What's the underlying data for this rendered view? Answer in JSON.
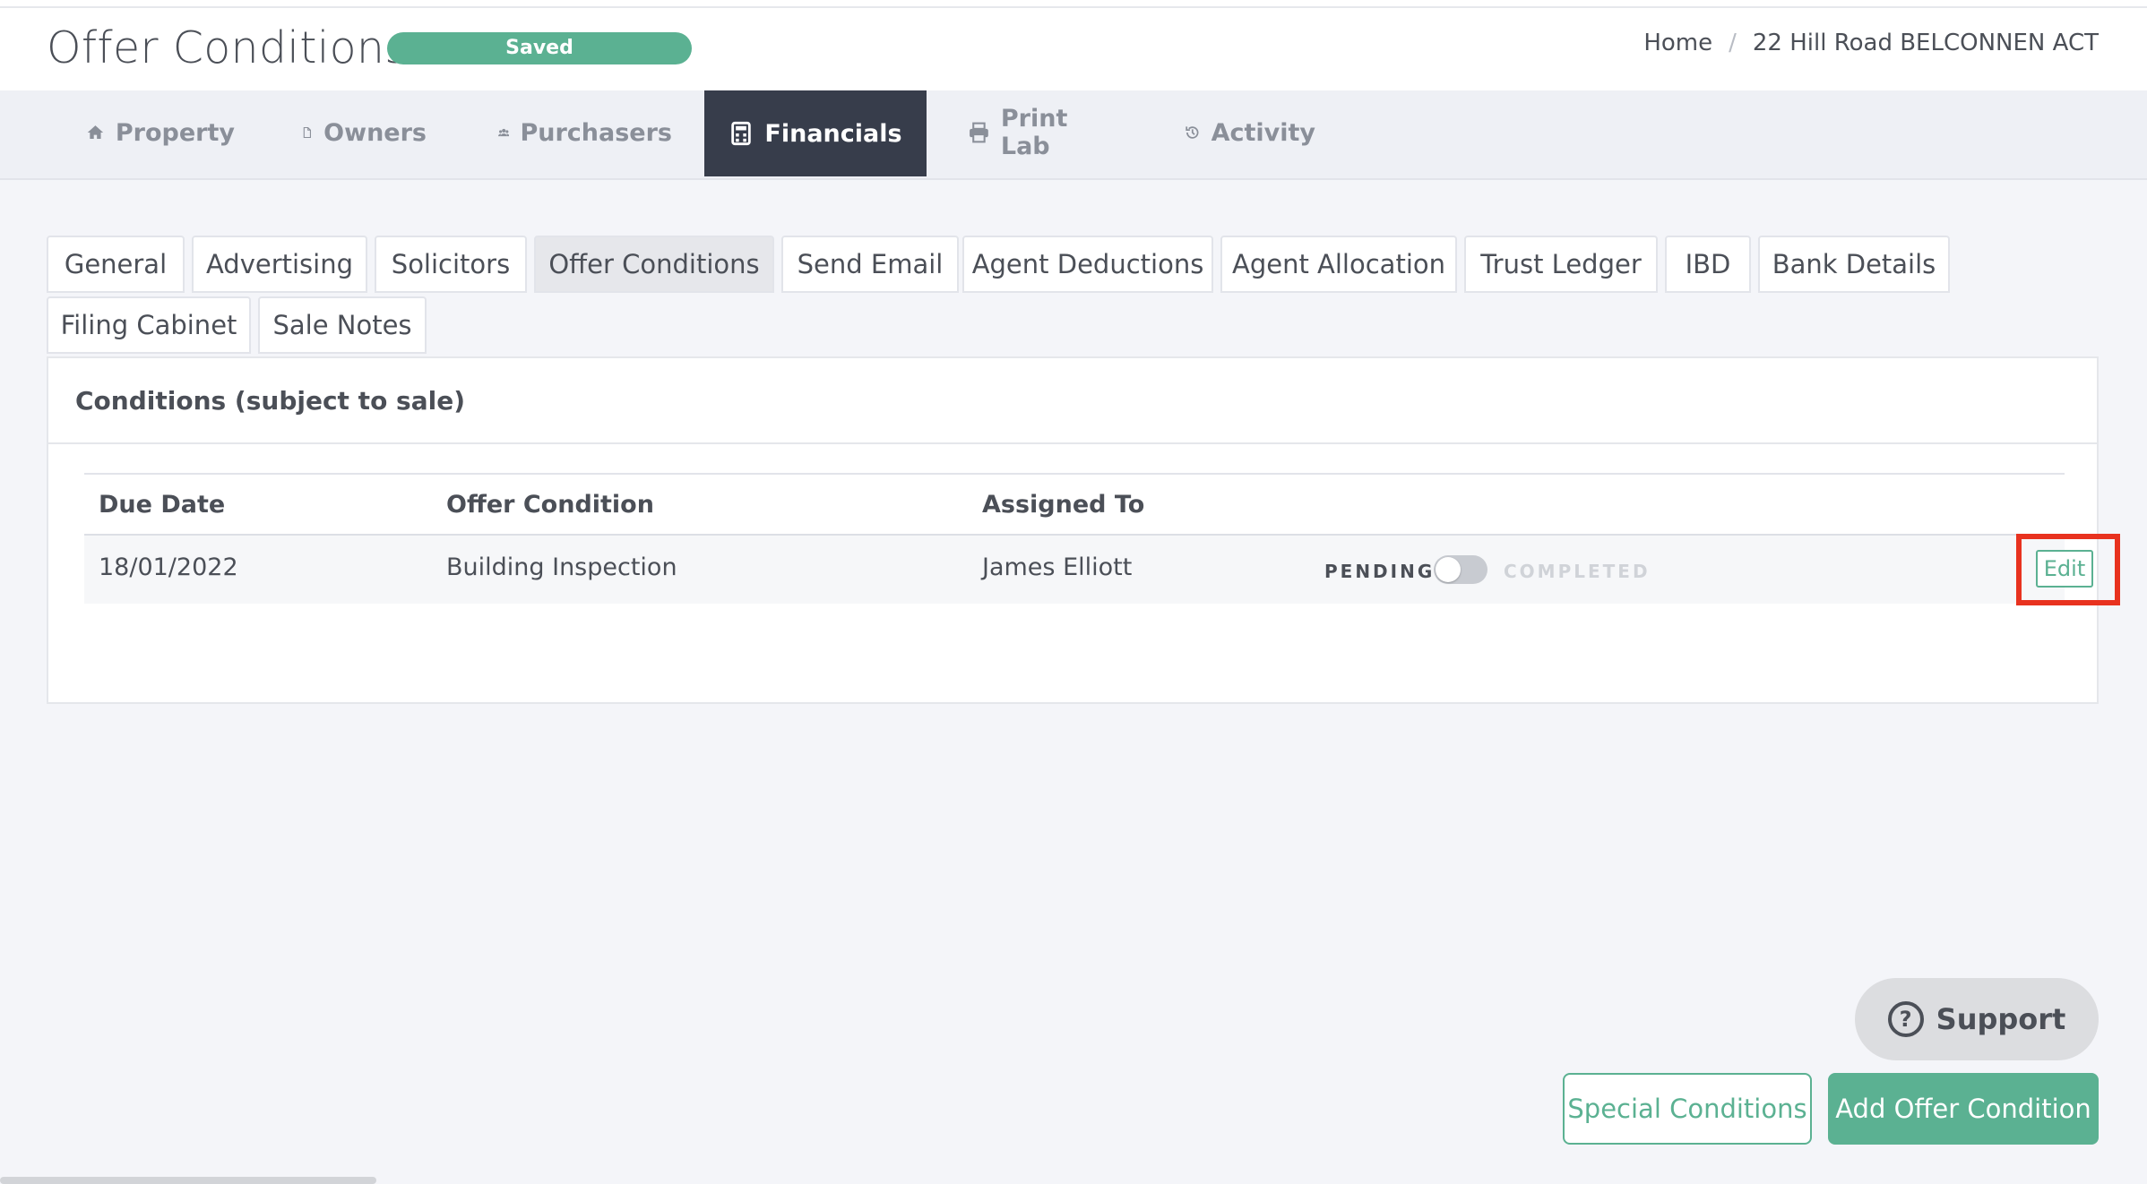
{
  "header": {
    "title": "Offer Conditions",
    "status_badge": "Saved",
    "breadcrumb": [
      "Home",
      "22 Hill Road BELCONNEN ACT"
    ]
  },
  "main_tabs": [
    {
      "label": "Property",
      "icon": "home-icon"
    },
    {
      "label": "Owners",
      "icon": "document-icon"
    },
    {
      "label": "Purchasers",
      "icon": "users-icon"
    },
    {
      "label": "Financials",
      "icon": "calculator-icon",
      "active": true
    },
    {
      "label": "Print Lab",
      "icon": "printer-icon"
    },
    {
      "label": "Activity",
      "icon": "history-icon"
    }
  ],
  "sub_tabs": [
    {
      "label": "General"
    },
    {
      "label": "Advertising"
    },
    {
      "label": "Solicitors"
    },
    {
      "label": "Offer Conditions",
      "active": true
    },
    {
      "label": "Send Email"
    },
    {
      "label": "Agent Deductions"
    },
    {
      "label": "Agent Allocation"
    },
    {
      "label": "Trust Ledger"
    },
    {
      "label": "IBD"
    },
    {
      "label": "Bank Details"
    },
    {
      "label": "Filing Cabinet"
    },
    {
      "label": "Sale Notes"
    }
  ],
  "conditions": {
    "heading": "Conditions (subject to sale)",
    "columns": [
      "Due Date",
      "Offer Condition",
      "Assigned To"
    ],
    "rows": [
      {
        "due_date": "18/01/2022",
        "condition": "Building Inspection",
        "assigned_to": "James Elliott",
        "toggle_off_label": "PENDING",
        "toggle_on_label": "COMPLETED",
        "completed": false,
        "edit_label": "Edit"
      }
    ]
  },
  "support_label": "Support",
  "actions": {
    "special_conditions": "Special Conditions",
    "add_offer_condition": "Add Offer Condition"
  },
  "colors": {
    "accent": "#5bb192",
    "nav_active": "#373d4b",
    "highlight": "#e8321f"
  }
}
